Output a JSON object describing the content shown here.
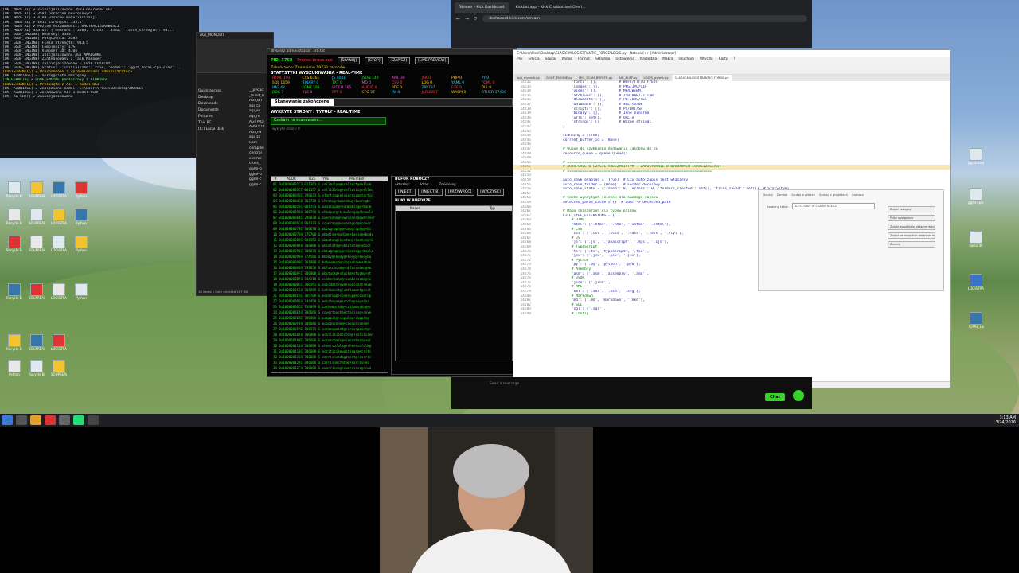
{
  "terminal": {
    "lines": [
      "[OK] MÓZG AI] ✔ Zainicjalizowano 3583 neuronów AGI",
      "[OK] MÓZG AI] ✔ 3583 połączeń neuronowych",
      "[OK] MÓZG AI] ✔ 4104 wzorców materializacji",
      "[OK] MÓZG AI] ✔ 1611 strength: 133.5",
      "[OK] MÓZG AI] ✔ Poziom świadomości: RADYKALIZOKOWOŚCI",
      "[OK] MÓZG AI] Status: {'neurons': 3583, 'links': 3582, 'field_strength': 93...",
      "[OK] GGUF_ENGINE] Neurony: 3583",
      "[OK] GGUF_ENGINE] Połączenia: 3583",
      "[OK] GGUF_ENGINE] Field Strength: 933.5",
      "[OK] GGUF_ENGINE] Complexity: 11%",
      "[OK] GGUF_ENGINE] Vimodel 3D: 4104",
      "[OK] GGUF_ENGINE] Inicjalizowano AGI AMALGONE",
      "[OK] GGUF_ENGINE] Zintegrowany z Task Manager",
      "[OK] GGUF_ENGINE] Zainicjalizowano - TRYB LOKALNY",
      "[OK] GGUF_ENGINE] Status: {'initialized': true, 'model': 'gguf_local-cpu-sse2'...",
      "[LOGISTRANTIC] ✔ Uruchomiono z uprawnieniami administratora",
      "[OK] AIBRIDGE] ✔ Zaprzęgnięto dostępny",
      "[INTEGRACJA] ✔ GGUF_ENGINE podłączony z AIBRIDGE",
      "[LOGISTRANTIC] ✔ Przepięto z AI: 1 model OKJ",
      "[OK] AIBRIDGE] ✔ Znaleziono model: C:\\Users\\Pixel\\Desktop\\MODELS",
      "[OK] AIBRIDGE] ✔ Załadowano AI: 1 model GGUF",
      "[OK] AI CHAT] ✔ Zainicjalizowano"
    ]
  },
  "explorer": {
    "title": "AGI_MONOLIT",
    "nav": [
      "Quick access",
      "Desktop",
      "Downloads",
      "Documents",
      "Pictures",
      "This PC",
      "(C:) Local Disk"
    ],
    "files": [
      "__pycac",
      "_build_n",
      "AGI_Bri",
      "agi_co",
      "agi_ex",
      "agi_m",
      "AGI_MO",
      "ABSOLU",
      "AGI_Pa",
      "agi_sc",
      "Com",
      "compile",
      "central",
      "cosmic",
      "cross_",
      "ggml-b",
      "ggml-b",
      "ggml-c",
      "ggml-t"
    ],
    "status": "18 items   1 item selected  167 KB"
  },
  "monitor": {
    "window_title": "Wybierz administrator: 3rb.txt",
    "pid_label": "PID: 3768",
    "process_label": "Proces: brave.exe",
    "buttons": [
      "[SKANUJ]",
      "[STOP]",
      "[ZAPISZ]",
      "[LIVE PREVIEW]"
    ],
    "notice": "Zakończono: Znaleziono 19733 zasobów",
    "stats_title": "STATYSTYKI WYSZUKIWANIA - REAL-TIME",
    "stat_rows": [
      [
        "HTML 193",
        "CSS 6161",
        "JS 4041",
        "JSON 140",
        "XML 39",
        "JSX 0",
        "PHP 0",
        "PY 0"
      ],
      [
        "SQL 1659",
        "BINARY 0",
        "TXT 0",
        "MD 0",
        "CSV 0",
        "LOG 0",
        "YAML 0",
        "TOML 0"
      ],
      [
        "IMG 48",
        "FONT 181",
        "VIDEO 365",
        "AUDIO 0",
        "PDF 0",
        "ZIP 737",
        "EXE 0",
        "DLL 0"
      ],
      [
        "DOC 1",
        "XLS 0",
        "PPT 0",
        "CFG 37",
        "INI 0",
        "JAR 2287",
        "WASM 0",
        "OTHER 17430"
      ]
    ],
    "scan_label": "Skanowanie zakończone!",
    "pages_title": "WYKRYTE STRONY I TYTUŁY - REAL-TIME",
    "pages_notice": "Czekam na skanowanie...",
    "pages_sub": "wykryte strony: 0",
    "table_headers": [
      "#",
      "ADDR",
      "SIZE",
      "TYPE",
      "PREVIEW"
    ],
    "rows": [
      "01  0x10000001C3  011393  G  cellecion@+cellect@cellem",
      "02  0x10000003C7  001157  G  cell136tc@+cellotic@cellou",
      "03  0x100000045C  796633  G  startingcelsiornic@startin",
      "04  0x10000004E0  702738  G  chrono@+board4u@+board@b+",
      "05  0x100000055C  001753  G  oanzsapa@+bunmaking@+bunm",
      "06  0x10000005D4  706790  G  cheaper@+knowledge@+knowle",
      "07  0x100000064C  296030  G  cwerxone@+oweroner@cweroner",
      "08  0x10000006C4  004333  G  coverapp@+overappo@+cover",
      "09  0x100000073C  706678  G  obiography@+biography@+bi",
      "10  0x10000007B4  770700  G  obodie@+bodie@+bodie@+body",
      "11  0x100000082C  901553  G  oboston@+boston@+boston@+b",
      "12  0x10000008A4  706000  G  obsolete@+obsolete@+obsol",
      "13  0x100000091C  706678  G  cblography@+bioslog@+biolo",
      "14  0x1000000994  774566  G  bbody@+body@+body@+bodyba",
      "15  0x1000000A0C  701888  G  bshowmechanic@+showmechan",
      "16  0x1000000A84  791658  G  obfuscated@+obfuscated@+o",
      "17  0x1000000AFC  706000  G  obstuck@+stuck@+stuck@+st",
      "18  0x1000000B74  744218  G  cumbersome@+cumbersome@+c",
      "19  0x1000000BEC  706591  G  cooldestroy@+cooldestroy@",
      "20  0x1000000C64  708889  G  cetlament@+cetlament@+cet",
      "21  0x1000000CDC  705708  G  coverup@+coverup@+coverup",
      "22  0x1000000D54  744450  G  ooozhepas@+oozhepas@+ooz",
      "23  0x1000000DCC  736099  G  cathoworkd@+cathoworkd@+c",
      "24  0x1000000E44  706666  G  covertouchmechanics@+cove",
      "25  0x1000000EBC  700000  G  ocoppie@+coppie@+coppie@",
      "26  0x1000000F34  708686  G  ocoopscene@+cooopscene@+",
      "27  0x1000000FAC  706575  G  ocrosspoint@+crosspoint@+",
      "28  0x1000001024  700000  G  ocollisionscore@+collision",
      "29  0x100000109C  706666  G  ocrossbars@+crossbars@+cr",
      "30  0x1000001114  708888  G  cheersofolk@+cheersofolk@",
      "31  0x100000118C  706600  G  ocriticismwastings@+criti",
      "32  0x1000001204  700000  G  carrisnecdagtreat@+carris",
      "33  0x100000127C  706606  G  carrisnecfate@+carrisnec",
      "34  0x10000012F4  700000  G  cwarrisse@+cwarrisse@+cwa",
      "35  0x100000136C  706666  G  cwildgate@+wildgate@+wildg"
    ],
    "buffer_title": "BUFOR ROBOCZY",
    "buffer_labels": [
      "Aktualny:",
      "Adres:",
      "Zmieniony:"
    ],
    "buffer_buttons": [
      "[INJECT]",
      "[INJECT 8]",
      "[PRZYWRÓĆ]",
      "[WYCZYŚĆ]"
    ],
    "files_title": "PLIKI W BUFORZE",
    "files_headers": [
      "Nazwa",
      "Typ"
    ]
  },
  "notepad": {
    "title": "C:\\Users\\Pixel\\Desktop\\CLASIC\\MILOGISTRANTIC_FORGE\\LOGIS.py - Notepad++ [Administrator]",
    "menu": [
      "Plik",
      "Edycja",
      "Szukaj",
      "Widok",
      "Format",
      "Składnia",
      "Ustawienia",
      "Narzędzia",
      "Makra",
      "Uruchom",
      "Wtyczki",
      "Karty",
      "?"
    ],
    "tabs": [
      "agi_monolit.py",
      "GGUF_ENGINE.py",
      "MIO_SCAN_BUFFER.py",
      "AIB_BUFF.py",
      "LOGIS_pytest.py",
      "CLASIC\\MILOGISTRANTIC_FORGE.py"
    ],
    "code_lines": [
      [
        "14232",
        "    'fonts': [],          # WOFF/TTF/OTF/EOT"
      ],
      [
        "14233",
        "    'images': [],         # PNG/JPG/GIF"
      ],
      [
        "14234",
        "    'video': [],          # MP4/WEBM"
      ],
      [
        "14235",
        "    'archives': [],       # ZIP/RAR/7Z/TAR"
      ],
      [
        "14236",
        "    'documents': [],      # PDF/DOC/XLS"
      ],
      [
        "14237",
        "    'database': [],       # SQLite/DB"
      ],
      [
        "14238",
        "    'scripts': [],        # PS/BAT/SH"
      ],
      [
        "14239",
        "    'binary': [],         # Inne binarne"
      ],
      [
        "14240",
        "    'urls': set(),        # URL-e"
      ],
      [
        "14241",
        "    'strings': []         # Ważne stringi"
      ],
      [
        "14242",
        "}"
      ],
      [
        "14243",
        ""
      ],
      [
        "14244",
        "scanning = [True]"
      ],
      [
        "14245",
        "current_buffer_id = [None]"
      ],
      [
        "14246",
        ""
      ],
      [
        "14247",
        "# Queue do szybkiego dodawania zasobów do UI"
      ],
      [
        "14248",
        "resource_queue = queue.Queue()"
      ],
      [
        "14249",
        ""
      ],
      [
        "14250",
        "# ==================================================================="
      ],
      [
        "14251",
        "# AUTO-SAVE W CZASIE RZECZYWISTYM - ZAPISYWANIE W WYBRANYCH LOKALIZACJACH"
      ],
      [
        "14252",
        "# ==================================================================="
      ],
      [
        "14253",
        ""
      ],
      [
        "14254",
        "auto_save_enabled = [True]  # Czy auto-zapis jest włączony"
      ],
      [
        "14255",
        "auto_save_folder = [None]   # Folder docelowy"
      ],
      [
        "14256",
        "auto_save_state = {'saved': 0, 'errors': 0, 'folders_created': set(), 'files_saved': set()}  # Statystyki"
      ],
      [
        "14257",
        ""
      ],
      [
        "14258",
        "# Cache wykrytych ścieżek dla każdego zasobu"
      ],
      [
        "14259",
        "detected_paths_cache = {}  # addr -> detected_path"
      ],
      [
        "14260",
        ""
      ],
      [
        "14261",
        "# Mapa rozszerzeń dla typów plików"
      ],
      [
        "14262",
        "FILE_TYPE_EXTENSIONS = {"
      ],
      [
        "14263",
        "    # HTML"
      ],
      [
        "14264",
        "    'html': ['.html', '.htm', '.xhtml', '.shtml'],"
      ],
      [
        "14265",
        "    # CSS"
      ],
      [
        "14266",
        "    'css': ['.css', '.scss', '.sass', '.less', '.styl'],"
      ],
      [
        "14267",
        "    # JS"
      ],
      [
        "14268",
        "    'js': ['.js', '.javascript', '.mjs', '.cjs'],"
      ],
      [
        "14269",
        "    # TypeScript"
      ],
      [
        "14270",
        "    'ts': ['.ts', 'typescript', '.tsx'],"
      ],
      [
        "14271",
        "    'jsx': ['.jsx', '.jsx', '.jsx'],"
      ],
      [
        "14272",
        "    # Python"
      ],
      [
        "14273",
        "    'py': ['.py', 'python', '.pyw'],"
      ],
      [
        "14274",
        "    # Asembly"
      ],
      [
        "14275",
        "    'asm': ['.asm', 'assembly', '.asm'],"
      ],
      [
        "14276",
        "    # JSON"
      ],
      [
        "14277",
        "    'json': ['.json'],"
      ],
      [
        "14278",
        "    # XML"
      ],
      [
        "14279",
        "    'xml': ['.xml', '.xsd', '.svg'],"
      ],
      [
        "14280",
        "    # Markdown"
      ],
      [
        "14281",
        "    'md': ['.md', 'markdown', '.mkd'],"
      ],
      [
        "14282",
        "    # SQL"
      ],
      [
        "14283",
        "    'sql': ['.sql'],"
      ],
      [
        "14284",
        "    # Config"
      ]
    ],
    "status": "Python file      length : 905,128   lines : 15,975      Ln : 14,250   Col : 31   Sel : 0|0      Windows (CR LF)   UTF-8   INS"
  },
  "find_dialog": {
    "tabs": [
      "Szukaj",
      "Zamień",
      "Szukaj w plikach",
      "Szukaj w projektach",
      "Zaznacz"
    ],
    "find_label": "Szukany tekst:",
    "find_value": "AUTO-SAVE W CZASIE RZECZ",
    "buttons": [
      "Znajdź następny",
      "Policz wystąpienia",
      "Znajdź wszystkie w bieżącym dokumencie",
      "Znajdź we wszystkich otwartych dokumentach",
      "Zamknij"
    ]
  },
  "browser": {
    "tabs": [
      "Stream – Kick Dashboard",
      "Kickbot.app – Kick Chatbot and Overl…"
    ],
    "url": "dashboard.kick.com/stream"
  },
  "kick": {
    "chat_placeholder": "Send a message",
    "chat_button": "Chat"
  },
  "tray": {
    "time": "3:13 AM",
    "date": "3/24/2026"
  },
  "desktop_icons": [
    "ggml-base.dll",
    "ggml-cpu-sse42.dll",
    "llama.dll",
    "LOGISTRANTIC_1 CR.jpg",
    "TOTAL_Logistran tic_MULTISYS4M...",
    "Recycle Bin",
    "SOUPREALM",
    "LOGISTRANTIC_SUPER CODE",
    "Python"
  ]
}
